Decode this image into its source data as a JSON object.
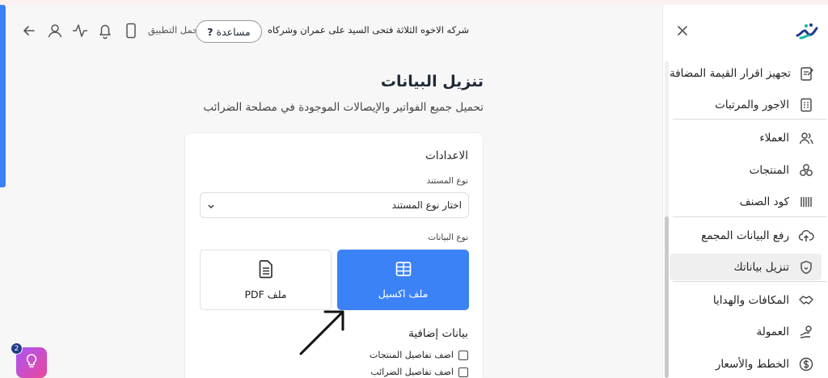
{
  "header": {
    "company": "شركه الاخوه الثلاثة فتحى السيد على عمران وشركاه",
    "help_label": "مساعدة",
    "help_icon": "?",
    "app_download": "حمل التطبيق"
  },
  "sidebar": {
    "items": [
      {
        "label": "تجهيز اقرار القيمة المضافة",
        "icon": "form-icon"
      },
      {
        "label": "الاجور والمرتبات",
        "icon": "payroll-icon"
      },
      {
        "label": "العملاء",
        "icon": "users-icon"
      },
      {
        "label": "المنتجات",
        "icon": "boxes-icon"
      },
      {
        "label": "كود الصنف",
        "icon": "barcode-icon"
      },
      {
        "label": "رفع البيانات المجمع",
        "icon": "cloud-upload-icon"
      },
      {
        "label": "تنزيل بياناتك",
        "icon": "shield-icon"
      },
      {
        "label": "المكافات والهدايا",
        "icon": "handshake-icon"
      },
      {
        "label": "العمولة",
        "icon": "commission-icon"
      },
      {
        "label": "الخطط والأسعار",
        "icon": "dollar-icon"
      }
    ]
  },
  "main": {
    "title": "تنزيل البيانات",
    "subtitle": "تحميل جميع الفواتير والإيصالات الموجودة في مصلحة الضرائب",
    "settings_title": "الاعدادات",
    "doc_type_label": "نوع المستند",
    "doc_type_value": "اختار نوع المستند",
    "data_type_label": "نوع البيانات",
    "excel_label": "ملف اكسيل",
    "pdf_label": "ملف PDF",
    "extra_title": "بيانات إضافية",
    "checkboxes": [
      {
        "label": "اضف تفاصيل المنتجات",
        "checked": false
      },
      {
        "label": "اضف تفاصيل الضرائب",
        "checked": false
      }
    ]
  },
  "fab": {
    "badge": "2"
  },
  "colors": {
    "accent": "#3b82f6",
    "fab_start": "#a855f7",
    "fab_end": "#ec4899"
  }
}
